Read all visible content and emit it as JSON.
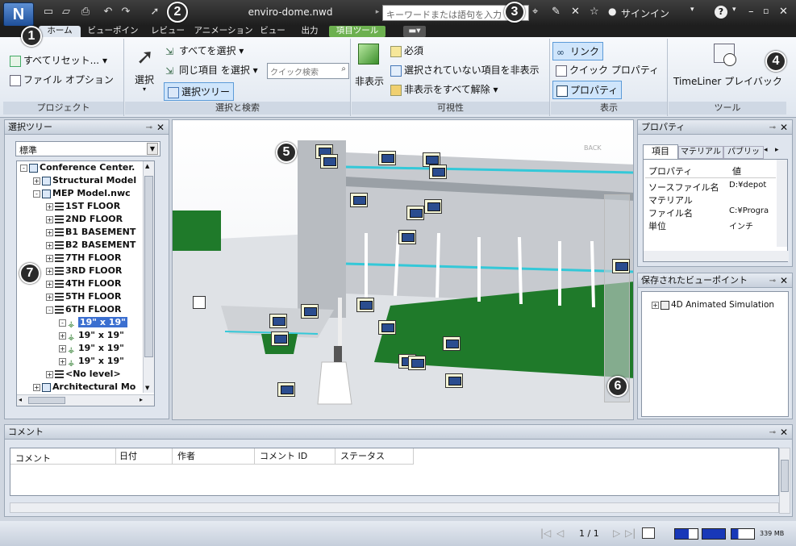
{
  "title_bar": {
    "app_button": "N",
    "window_title": "enviro-dome.nwd",
    "search_placeholder": "キーワードまたは語句を入力",
    "signin": "サインイン"
  },
  "tabs": [
    "ホーム",
    "ビューポイント",
    "レビュー",
    "アニメーション",
    "ビュー",
    "出力",
    "項目ツール"
  ],
  "ribbon": {
    "project": {
      "reset_all": "すべてリセット...",
      "file_options": "ファイル オプション",
      "label": "プロジェクト"
    },
    "select_search": {
      "select": "選択",
      "select_all": "すべてを選択",
      "select_same": "同じ項目 を選択",
      "quick_find_placeholder": "クイック検索",
      "selection_tree": "選択ツリー",
      "label": "選択と検索"
    },
    "visibility": {
      "hide": "非表示",
      "required": "必須",
      "hide_unselected": "選択されていない項目を非表示",
      "unhide_all": "非表示をすべて解除",
      "label": "可視性"
    },
    "display": {
      "links": "リンク",
      "quick_properties": "クイック プロパティ",
      "properties": "プロパティ",
      "label": "表示"
    },
    "tools": {
      "timeliner": "TimeLiner プレイバック",
      "label": "ツール"
    }
  },
  "selection_tree": {
    "title": "選択ツリー",
    "mode": "標準",
    "items": [
      {
        "label": "Conference Center.",
        "indent": 0,
        "exp": "-",
        "selected": false
      },
      {
        "label": "Structural Model",
        "indent": 1,
        "exp": "+",
        "selected": false
      },
      {
        "label": "MEP Model.nwc",
        "indent": 1,
        "exp": "-",
        "selected": false
      },
      {
        "label": "1ST FLOOR",
        "indent": 2,
        "exp": "+",
        "selected": false
      },
      {
        "label": "2ND FLOOR",
        "indent": 2,
        "exp": "+",
        "selected": false
      },
      {
        "label": "B1 BASEMENT",
        "indent": 2,
        "exp": "+",
        "selected": false
      },
      {
        "label": "B2  BASEMENT",
        "indent": 2,
        "exp": "+",
        "selected": false
      },
      {
        "label": "7TH FLOOR",
        "indent": 2,
        "exp": "+",
        "selected": false
      },
      {
        "label": "3RD FLOOR",
        "indent": 2,
        "exp": "+",
        "selected": false
      },
      {
        "label": "4TH FLOOR",
        "indent": 2,
        "exp": "+",
        "selected": false
      },
      {
        "label": "5TH FLOOR",
        "indent": 2,
        "exp": "+",
        "selected": false
      },
      {
        "label": "6TH FLOOR",
        "indent": 2,
        "exp": "-",
        "selected": false
      },
      {
        "label": "19\" x 19\"",
        "indent": 3,
        "exp": "-",
        "selected": true
      },
      {
        "label": "19\" x 19\"",
        "indent": 3,
        "exp": "+",
        "selected": false
      },
      {
        "label": "19\" x 19\"",
        "indent": 3,
        "exp": "+",
        "selected": false
      },
      {
        "label": "19\" x 19\"",
        "indent": 3,
        "exp": "+",
        "selected": false
      },
      {
        "label": "<No level>",
        "indent": 2,
        "exp": "+",
        "selected": false
      },
      {
        "label": "Architectural Mo",
        "indent": 1,
        "exp": "+",
        "selected": false
      }
    ]
  },
  "properties": {
    "title": "プロパティ",
    "tabs": [
      "項目",
      "マテリアル",
      "パブリッシ"
    ],
    "col_property": "プロパティ",
    "col_value": "値",
    "rows": [
      {
        "k": "ソースファイル名",
        "v": "D:¥depot"
      },
      {
        "k": "マテリアル",
        "v": ""
      },
      {
        "k": "ファイル名",
        "v": "C:¥Progra"
      },
      {
        "k": "単位",
        "v": "インチ"
      }
    ]
  },
  "saved_viewpoints": {
    "title": "保存されたビューポイント",
    "items": [
      "4D Animated Simulation"
    ]
  },
  "comments": {
    "title": "コメント",
    "columns": [
      "コメント",
      "日付",
      "作者",
      "コメント ID",
      "ステータス"
    ]
  },
  "status": {
    "page": "1 / 1",
    "memory": "339 MB"
  },
  "viewcube_label": "BACK",
  "callouts": [
    "1",
    "2",
    "3",
    "4",
    "5",
    "6",
    "7"
  ],
  "colors": {
    "accent_green": "#6cb04f",
    "floor_green": "#1f7a2a",
    "cyan": "#34c8d8",
    "title_bg": "#2a2a2a"
  }
}
